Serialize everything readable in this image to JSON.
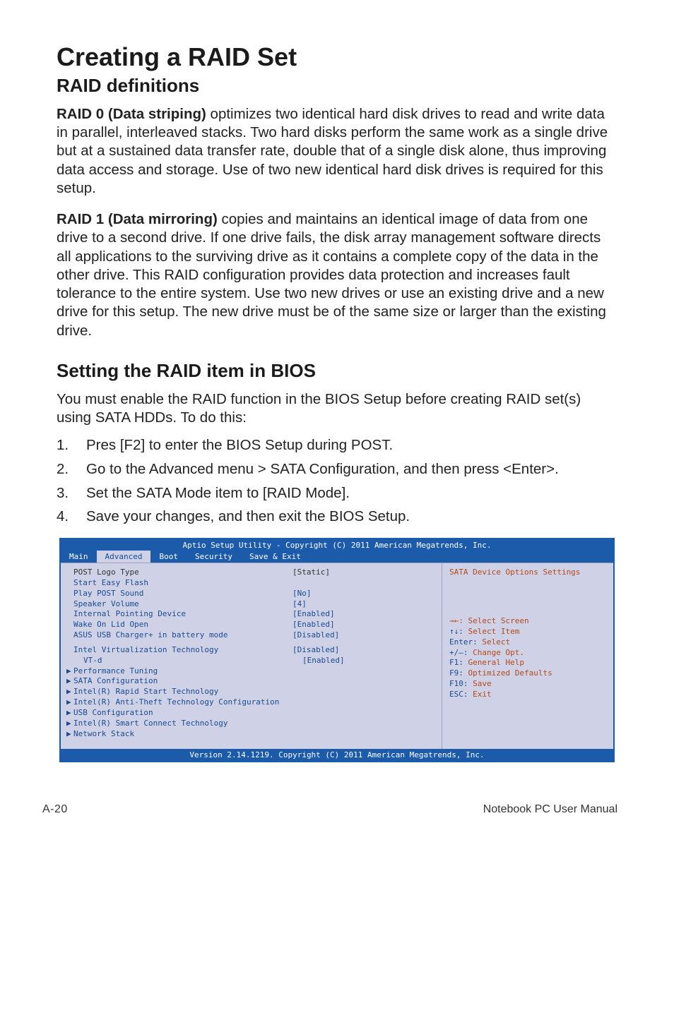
{
  "title": "Creating a RAID Set",
  "subtitle_defs": "RAID definitions",
  "para1_lead": "RAID 0 (Data striping)",
  "para1_rest": " optimizes two identical hard disk drives to read and write data in parallel, interleaved stacks. Two hard disks perform the same work as a single drive but at a sustained data transfer rate, double that of a single disk alone, thus improving data access and storage. Use of two new identical hard disk drives is required for this setup.",
  "para2_lead": "RAID 1 (Data mirroring)",
  "para2_rest": " copies and maintains an identical image of data from one drive to a second drive. If one drive fails, the disk array management software directs all applications to the surviving drive as it contains a complete copy of the data in the other drive. This RAID configuration provides data protection and increases fault tolerance to the entire system. Use two new drives or use an existing drive and a new drive for this setup. The new drive must be of the same size or larger than the existing drive.",
  "subtitle_setting": "Setting the RAID item in BIOS",
  "intro_setting": "You must enable the RAID function in the BIOS Setup before creating RAID set(s) using SATA HDDs. To do this:",
  "steps": [
    {
      "n": "1.",
      "t_pre": "Pres [F2] to enter the BIOS Setup during POST.",
      "t_bold1": "",
      "t_mid": "",
      "t_bold2": "",
      "t_post": ""
    },
    {
      "n": "2.",
      "t_pre": "Go to the ",
      "t_bold1": "Advanced",
      "t_mid": " menu > ",
      "t_bold2": "SATA Configuration",
      "t_post": ", and then press <Enter>."
    },
    {
      "n": "3.",
      "t_pre": "Set the ",
      "t_bold1": "SATA Mode",
      "t_mid": " item to [RAID Mode].",
      "t_bold2": "",
      "t_post": ""
    },
    {
      "n": "4.",
      "t_pre": "Save your changes, and then exit the BIOS Setup.",
      "t_bold1": "",
      "t_mid": "",
      "t_bold2": "",
      "t_post": ""
    }
  ],
  "bios": {
    "header": "Aptio Setup Utility - Copyright (C) 2011 American Megatrends, Inc.",
    "tabs": [
      "Main",
      "Advanced",
      "Boot",
      "Security",
      "Save & Exit"
    ],
    "active_tab": "Advanced",
    "rows_top": [
      {
        "label": "POST Logo Type",
        "val": "[Static]",
        "head": true
      },
      {
        "label": "Start Easy Flash",
        "val": ""
      },
      {
        "label": "Play POST Sound",
        "val": "[No]"
      },
      {
        "label": "Speaker Volume",
        "val": "[4]"
      },
      {
        "label": "Internal Pointing Device",
        "val": "[Enabled]"
      },
      {
        "label": "Wake On Lid Open",
        "val": "[Enabled]"
      },
      {
        "label": "ASUS USB Charger+ in battery mode",
        "val": "[Disabled]"
      }
    ],
    "rows_mid": [
      {
        "label": "Intel Virtualization Technology",
        "val": "[Disabled]"
      },
      {
        "label": "VT-d",
        "val": "[Enabled]"
      }
    ],
    "rows_sub": [
      "Performance Tuning",
      "SATA Configuration",
      "Intel(R) Rapid Start Technology",
      "Intel(R) Anti-Theft Technology Configuration",
      "USB Configuration",
      "Intel(R) Smart Connect Technology",
      "Network Stack"
    ],
    "help_desc": "SATA Device Options Settings",
    "keyhelp": [
      {
        "k": "→←:",
        "d": "Select Screen",
        "arrows": true
      },
      {
        "k": "↑↓:",
        "d": "Select Item"
      },
      {
        "k": "Enter:",
        "d": "Select"
      },
      {
        "k": "+/—:",
        "d": "Change Opt."
      },
      {
        "k": "F1:",
        "d": "General Help"
      },
      {
        "k": "F9:",
        "d": "Optimized Defaults"
      },
      {
        "k": "F10:",
        "d": "Save"
      },
      {
        "k": "ESC:",
        "d": "Exit"
      }
    ],
    "footer": "Version 2.14.1219. Copyright (C) 2011 American Megatrends, Inc."
  },
  "page_footer_left": "A-20",
  "page_footer_right": "Notebook PC User Manual"
}
